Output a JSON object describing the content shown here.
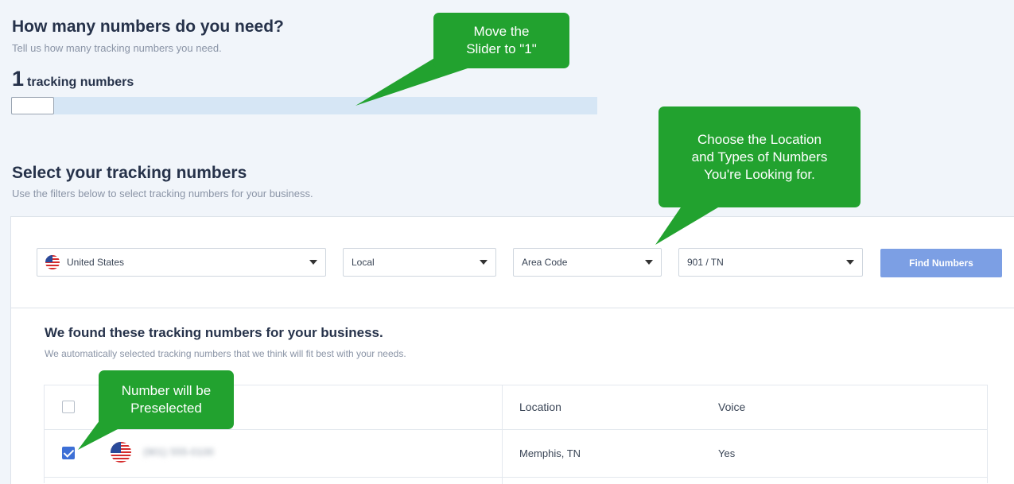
{
  "numbers_section": {
    "title": "How many numbers do you need?",
    "subtitle": "Tell us how many tracking numbers you need.",
    "count": "1",
    "count_unit": "tracking numbers",
    "slider_value_fraction": 0
  },
  "select_section": {
    "title": "Select your tracking numbers",
    "subtitle": "Use the filters below to select tracking numbers for your business."
  },
  "filters": {
    "country": "United States",
    "type": "Local",
    "search_by": "Area Code",
    "area": "901 / TN",
    "find_button": "Find Numbers"
  },
  "results": {
    "title": "We found these tracking numbers for your business.",
    "subtitle": "We automatically selected tracking numbers that we think will fit best with your needs.",
    "columns": {
      "location": "Location",
      "voice": "Voice"
    },
    "rows": [
      {
        "number": "(901) 555-0100",
        "location": "Memphis, TN",
        "voice": "Yes",
        "selected": true
      }
    ]
  },
  "callouts": {
    "slider": "Move the\nSlider to \"1\"",
    "filters": "Choose the Location\nand Types of Numbers\nYou're Looking for.",
    "preselected": "Number will be\nPreselected"
  },
  "colors": {
    "callout_green": "#22a22f",
    "button_blue": "#7c9fe4",
    "checkbox_blue": "#3d6fd6",
    "page_bg": "#f1f5fa",
    "slider_track": "#d6e6f5"
  }
}
